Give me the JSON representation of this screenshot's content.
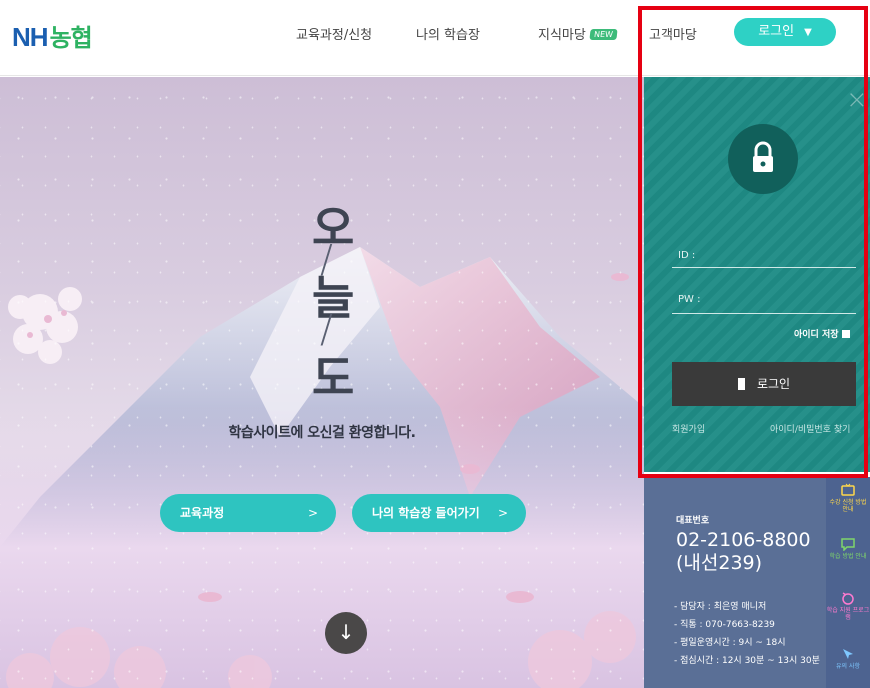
{
  "header": {
    "logo_nh": "NH",
    "logo_kr": "농협",
    "nav": [
      "교육과정/신청",
      "나의 학습장",
      "지식마당",
      "고객마당"
    ],
    "new_badge": "NEW",
    "login_toggle": "로그인"
  },
  "hero": {
    "title_chars": [
      "오",
      "늘",
      "도"
    ],
    "welcome": "학습사이트에 오신걸 환영합니다.",
    "buttons": [
      "교육과정",
      "나의 학습장 들어가기"
    ],
    "button_arrow": ">"
  },
  "login": {
    "id_label": "ID :",
    "pw_label": "PW :",
    "save_id": "아이디 저장",
    "submit": "로그인",
    "signup": "회원가입",
    "find": "아이디/비밀번호 찾기"
  },
  "contact": {
    "label": "대표번호",
    "phone": "02-2106-8800",
    "ext": "(내선239)",
    "lines": [
      "- 담당자 : 최은영 매니저",
      "- 직통 : 070-7663-8239",
      "- 평일운영시간 : 9시 ~ 18시",
      "- 점심시간 : 12시 30분 ~ 13시 30분"
    ]
  },
  "quick_links": [
    {
      "text": "수강 신청 방법 안내",
      "icon": "tv-icon",
      "color": "#ffd84a"
    },
    {
      "text": "학습 방법 안내",
      "icon": "chat-icon",
      "color": "#7fd66a"
    },
    {
      "text": "학습 지원 프로그램",
      "icon": "mouse-icon",
      "color": "#ff7ad0"
    },
    {
      "text": "유의 사항",
      "icon": "pin-icon",
      "color": "#7fc8ff"
    }
  ],
  "colors": {
    "accent": "#2ed1c5",
    "panel": "#1f8c86",
    "contact": "#5a6f96",
    "highlight_frame": "#e60012"
  }
}
